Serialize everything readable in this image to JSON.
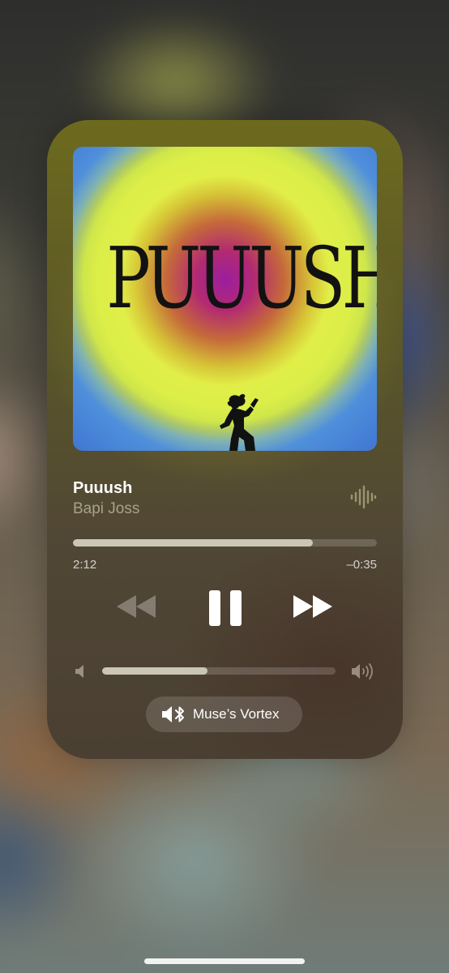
{
  "now_playing": {
    "album_art": {
      "title_text": "PUUUSH",
      "figure_icon": "running-figure-silhouette"
    },
    "track_title": "Puuush",
    "artist": "Bapi Joss",
    "playback_progress": 0.79,
    "time_elapsed": "2:12",
    "time_remaining": "–0:35",
    "transport": {
      "rewind_icon": "backward-icon",
      "pause_icon": "pause-icon",
      "forward_icon": "forward-icon"
    },
    "volume_level": 0.45,
    "output_device": {
      "icon": "speaker-bluetooth-icon",
      "label": "Muse’s Vortex"
    }
  },
  "colors": {
    "card_tint": "#5f5a25",
    "fill_track": "#ebe8d7",
    "text_primary": "#ffffff"
  }
}
